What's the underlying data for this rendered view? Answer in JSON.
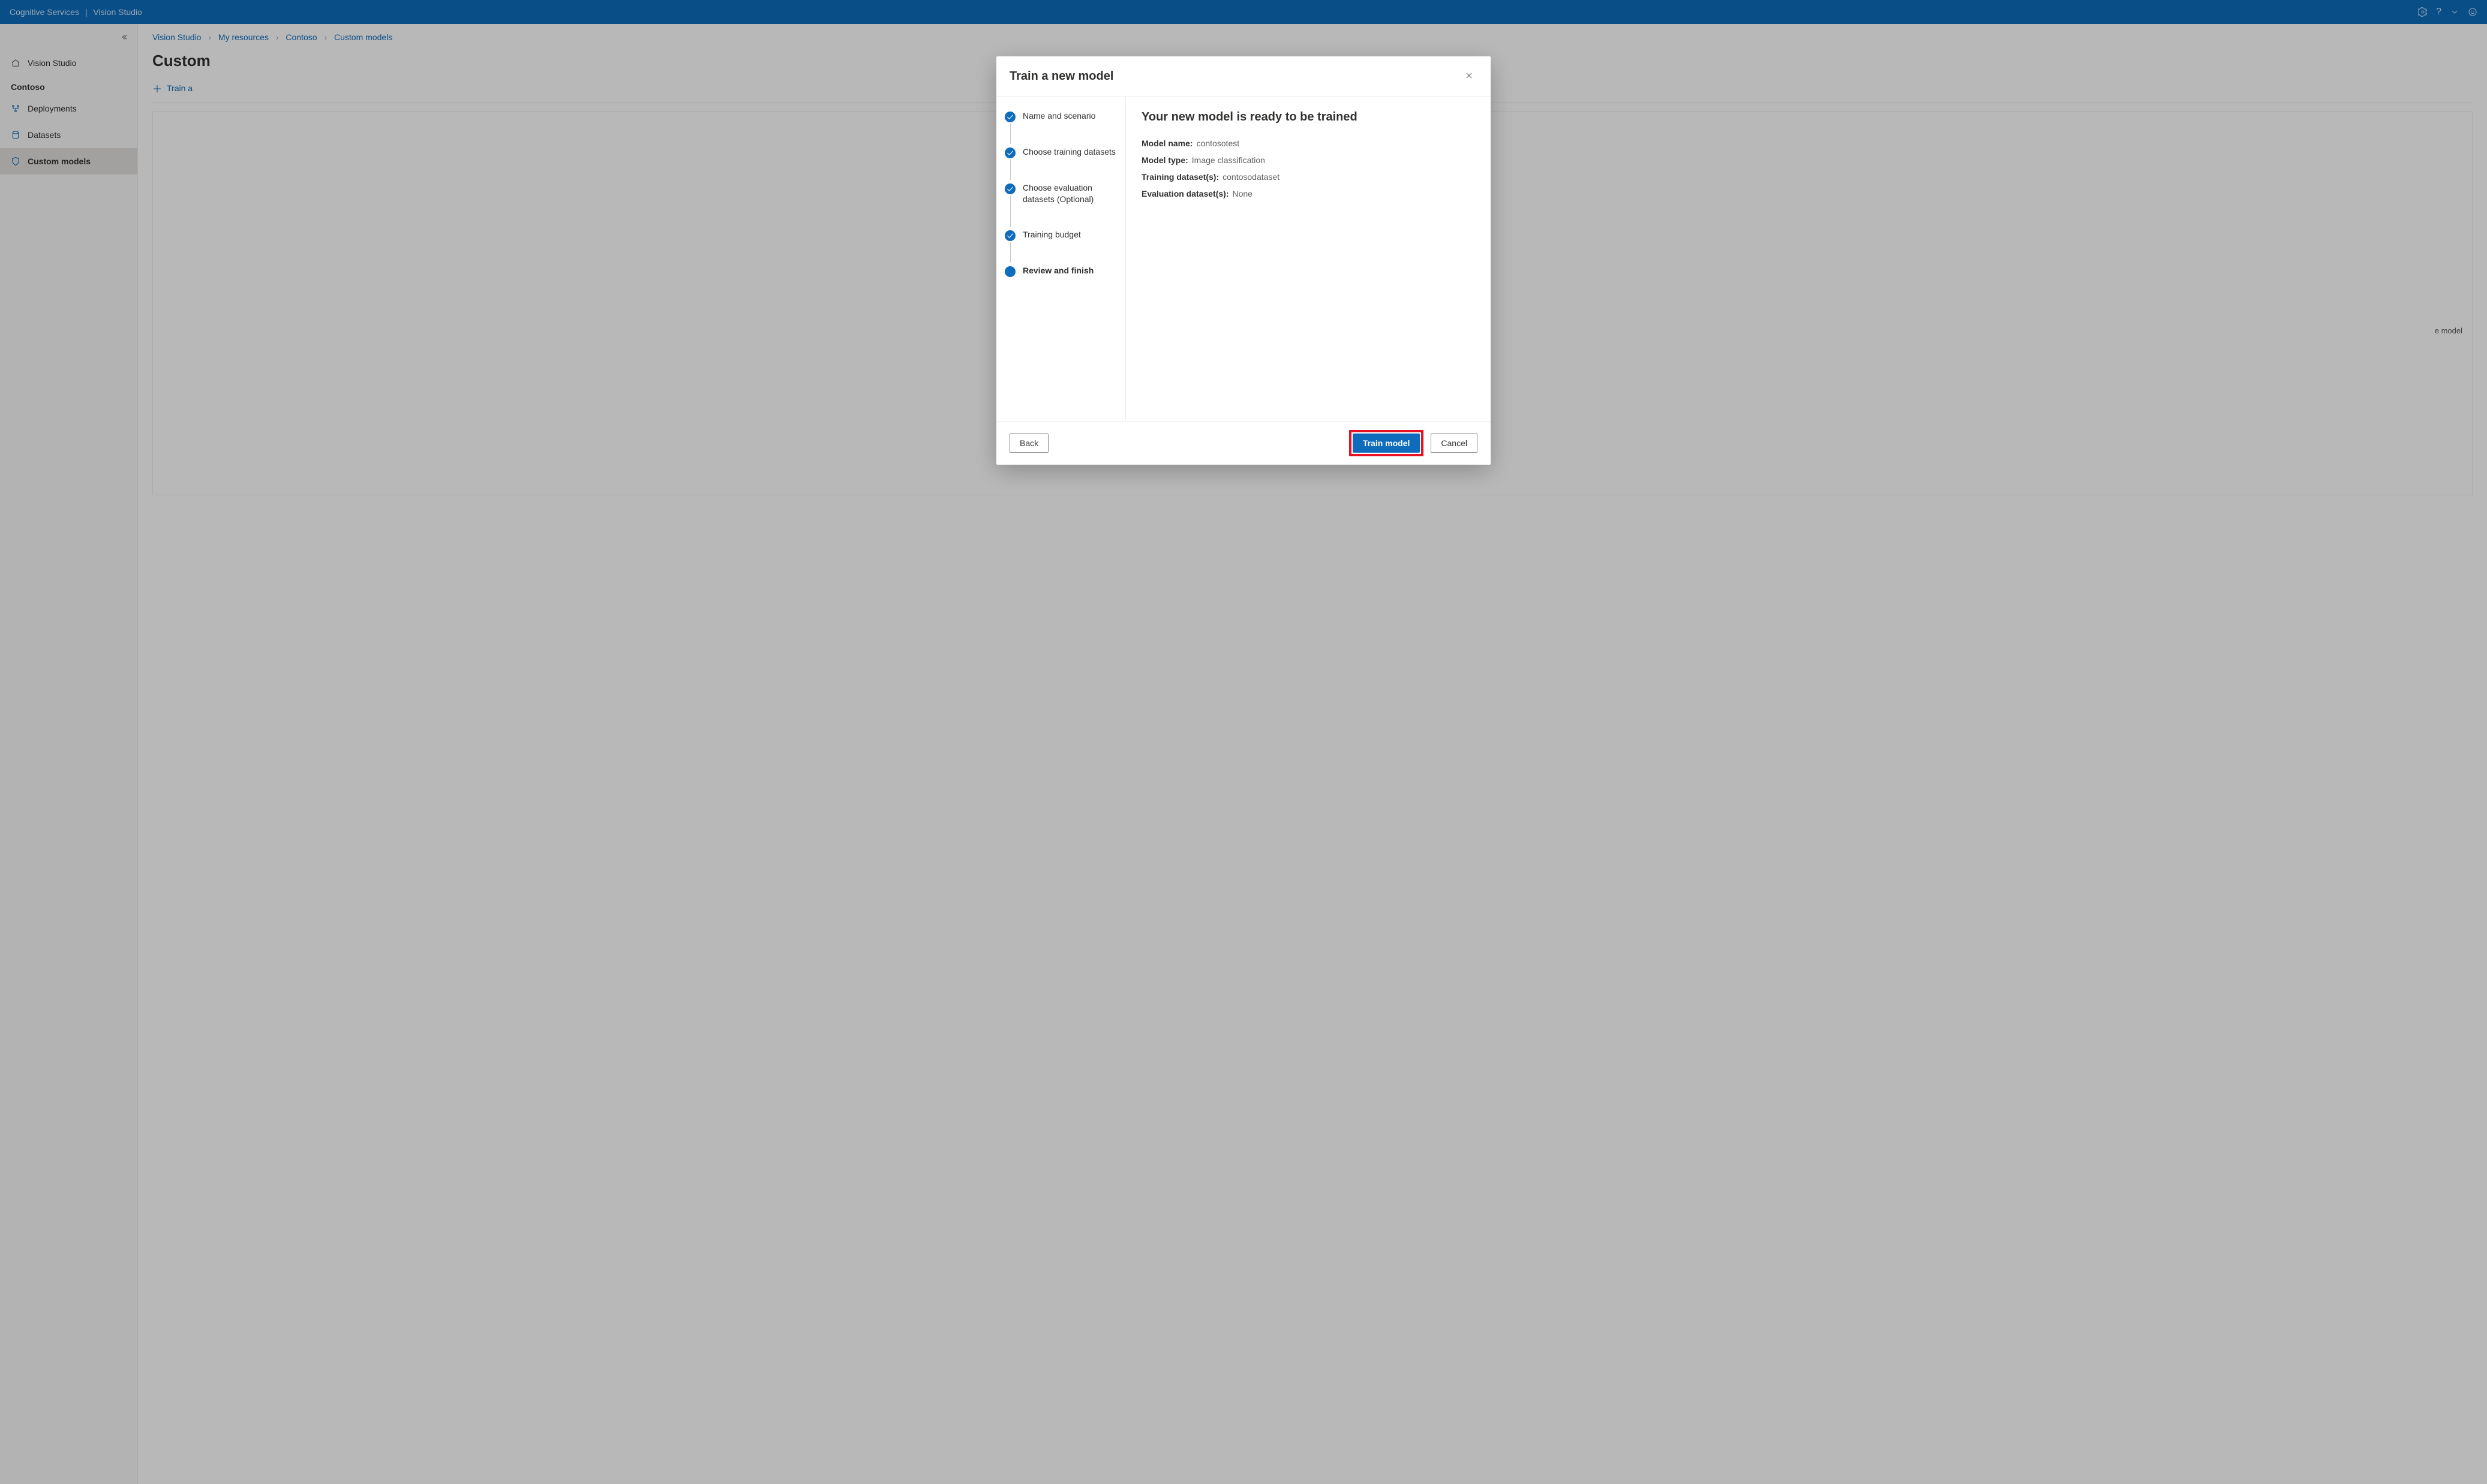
{
  "topbar": {
    "brand_left": "Cognitive Services",
    "brand_right": "Vision Studio"
  },
  "sidebar": {
    "home_label": "Vision Studio",
    "resource_label": "Contoso",
    "items": [
      {
        "label": "Deployments"
      },
      {
        "label": "Datasets"
      },
      {
        "label": "Custom models"
      }
    ]
  },
  "breadcrumbs": [
    "Vision Studio",
    "My resources",
    "Contoso",
    "Custom models"
  ],
  "page": {
    "title_partial": "Custom",
    "toolbar_train": "Train a",
    "hint_right": "e model"
  },
  "dialog": {
    "title": "Train a new model",
    "steps": [
      "Name and scenario",
      "Choose training datasets",
      "Choose evaluation datasets (Optional)",
      "Training budget",
      "Review and finish"
    ],
    "review": {
      "heading": "Your new model is ready to be trained",
      "rows": [
        {
          "k": "Model name:",
          "v": "contosotest"
        },
        {
          "k": "Model type:",
          "v": "Image classification"
        },
        {
          "k": "Training dataset(s):",
          "v": "contosodataset"
        },
        {
          "k": "Evaluation dataset(s):",
          "v": "None"
        }
      ]
    },
    "buttons": {
      "back": "Back",
      "train": "Train model",
      "cancel": "Cancel"
    }
  }
}
